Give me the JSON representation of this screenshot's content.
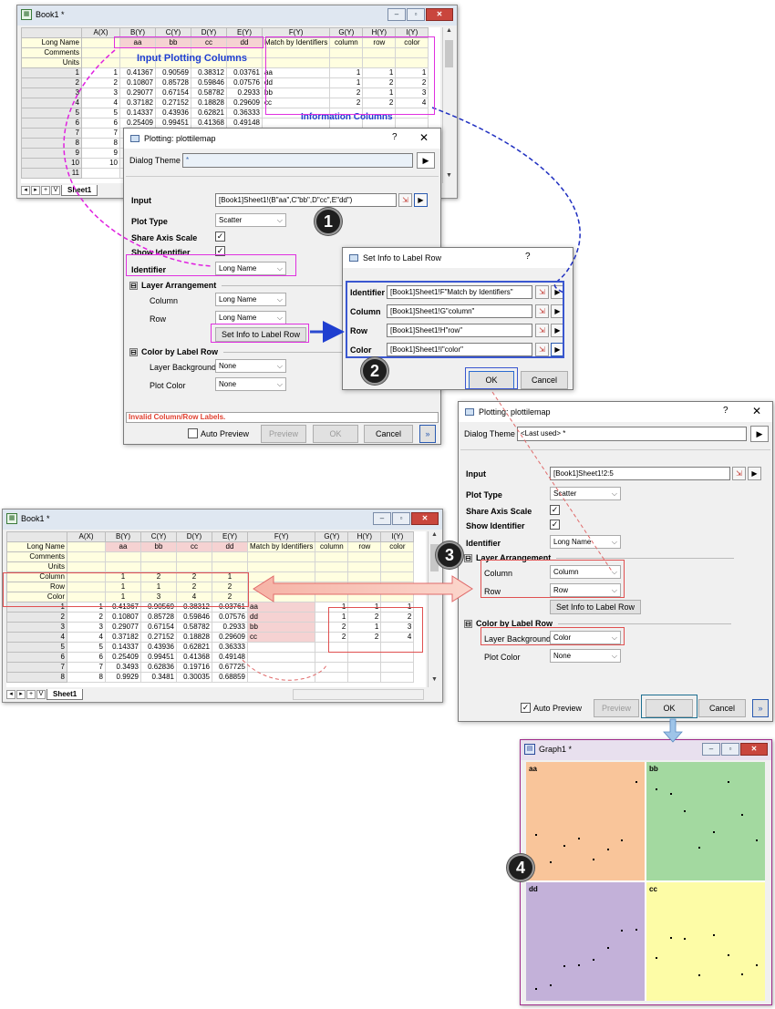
{
  "book_top": {
    "title": "Book1 *",
    "col_headers": [
      "A(X)",
      "B(Y)",
      "C(Y)",
      "D(Y)",
      "E(Y)",
      "F(Y)",
      "G(Y)",
      "H(Y)",
      "I(Y)"
    ],
    "row_labels": [
      "Long Name",
      "Comments",
      "Units"
    ],
    "long_names": [
      "",
      "aa",
      "bb",
      "cc",
      "dd",
      "Match by Identifiers",
      "column",
      "row",
      "color"
    ],
    "rows": [
      [
        "1",
        "1",
        "0.41367",
        "0.90569",
        "0.38312",
        "0.03761",
        "aa",
        "1",
        "1",
        "1"
      ],
      [
        "2",
        "2",
        "0.10807",
        "0.85728",
        "0.59846",
        "0.07576",
        "dd",
        "1",
        "2",
        "2"
      ],
      [
        "3",
        "3",
        "0.29077",
        "0.67154",
        "0.58782",
        "0.2933",
        "bb",
        "2",
        "1",
        "3"
      ],
      [
        "4",
        "4",
        "0.37182",
        "0.27152",
        "0.18828",
        "0.29609",
        "cc",
        "2",
        "2",
        "4"
      ],
      [
        "5",
        "5",
        "0.14337",
        "0.43936",
        "0.62821",
        "0.36333",
        "",
        "",
        "",
        ""
      ],
      [
        "6",
        "6",
        "0.25409",
        "0.99451",
        "0.41368",
        "0.49148",
        "",
        "",
        "",
        ""
      ],
      [
        "7",
        "7",
        "",
        "",
        "",
        "",
        "",
        "",
        "",
        ""
      ],
      [
        "8",
        "8",
        "",
        "",
        "",
        "",
        "",
        "",
        "",
        ""
      ],
      [
        "9",
        "9",
        "0.",
        "",
        "",
        "",
        "",
        "",
        "",
        ""
      ],
      [
        "10",
        "10",
        "0.",
        "",
        "",
        "",
        "",
        "",
        "",
        ""
      ],
      [
        "11",
        "",
        "",
        "",
        "",
        "",
        "",
        "",
        "",
        ""
      ]
    ],
    "sheet_tab": "Sheet1",
    "nav_buttons": [
      "◂",
      "▸",
      "+",
      "V"
    ]
  },
  "annotations": {
    "input_cols": "Input Plotting Columns",
    "info_cols": "Information Columns"
  },
  "dialog1": {
    "title": "Plotting: plottilemap",
    "help": "?",
    "close": "✕",
    "theme_label": "Dialog Theme",
    "theme_value": "*",
    "input_label": "Input",
    "input_value": "[Book1]Sheet1!(B\"aa\",C\"bb\",D\"cc\",E\"dd\")",
    "plot_type_label": "Plot Type",
    "plot_type_value": "Scatter",
    "share_axis_label": "Share Axis Scale",
    "show_identifier_label": "Show Identifier",
    "identifier_label": "Identifier",
    "identifier_value": "Long Name",
    "layer_arr_label": "Layer Arrangement",
    "column_label": "Column",
    "column_value": "Long Name",
    "row_label": "Row",
    "row_value": "Long Name",
    "set_info_btn": "Set Info to Label Row",
    "color_by_label": "Color by Label Row",
    "layer_bg_label": "Layer Background",
    "layer_bg_value": "None",
    "plot_color_label": "Plot Color",
    "plot_color_value": "None",
    "status": "Invalid Column/Row Labels.",
    "auto_preview": "Auto Preview",
    "preview_btn": "Preview",
    "ok_btn": "OK",
    "cancel_btn": "Cancel",
    "more_btn": "»",
    "expand": "⊟"
  },
  "setinfo": {
    "title": "Set Info to Label Row",
    "help": "?",
    "identifier_label": "Identifier",
    "identifier_value": "[Book1]Sheet1!F\"Match by Identifiers\"",
    "column_label": "Column",
    "column_value": "[Book1]Sheet1!G\"column\"",
    "row_label": "Row",
    "row_value": "[Book1]Sheet1!H\"row\"",
    "color_label": "Color",
    "color_value": "[Book1]Sheet1!I\"color\"",
    "ok_btn": "OK",
    "cancel_btn": "Cancel"
  },
  "dialog2": {
    "title": "Plotting: plottilemap",
    "help": "?",
    "close": "✕",
    "theme_label": "Dialog Theme",
    "theme_value": "<Last used> *",
    "input_label": "Input",
    "input_value": "[Book1]Sheet1!2:5",
    "plot_type_label": "Plot Type",
    "plot_type_value": "Scatter",
    "share_axis_label": "Share Axis Scale",
    "show_identifier_label": "Show Identifier",
    "identifier_label": "Identifier",
    "identifier_value": "Long Name",
    "layer_arr_label": "Layer Arrangement",
    "column_label": "Column",
    "column_value": "Column",
    "row_label": "Row",
    "row_value": "Row",
    "set_info_btn": "Set Info to Label Row",
    "color_by_label": "Color by Label Row",
    "layer_bg_label": "Layer Background",
    "layer_bg_value": "Color",
    "plot_color_label": "Plot Color",
    "plot_color_value": "None",
    "auto_preview": "Auto Preview",
    "preview_btn": "Preview",
    "ok_btn": "OK",
    "cancel_btn": "Cancel",
    "more_btn": "»"
  },
  "book_bottom": {
    "title": "Book1 *",
    "col_headers": [
      "A(X)",
      "B(Y)",
      "C(Y)",
      "D(Y)",
      "E(Y)",
      "F(Y)",
      "G(Y)",
      "H(Y)",
      "I(Y)"
    ],
    "long_names": [
      "",
      "aa",
      "bb",
      "cc",
      "dd",
      "Match by Identifiers",
      "column",
      "row",
      "color"
    ],
    "label_rows": [
      {
        "name": "Long Name",
        "vals": [
          "",
          "aa",
          "bb",
          "cc",
          "dd",
          "Match by Identifiers",
          "column",
          "row",
          "color"
        ]
      },
      {
        "name": "Comments",
        "vals": [
          "",
          "",
          "",
          "",
          "",
          "",
          "",
          "",
          ""
        ]
      },
      {
        "name": "Units",
        "vals": [
          "",
          "",
          "",
          "",
          "",
          "",
          "",
          "",
          ""
        ]
      },
      {
        "name": "Column",
        "vals": [
          "",
          "1",
          "2",
          "2",
          "1",
          "",
          "",
          "",
          ""
        ]
      },
      {
        "name": "Row",
        "vals": [
          "",
          "1",
          "1",
          "2",
          "2",
          "",
          "",
          "",
          ""
        ]
      },
      {
        "name": "Color",
        "vals": [
          "",
          "1",
          "3",
          "4",
          "2",
          "",
          "",
          "",
          ""
        ]
      }
    ],
    "rows": [
      [
        "1",
        "1",
        "0.41367",
        "0.90569",
        "0.38312",
        "0.03761",
        "aa",
        "1",
        "1",
        "1"
      ],
      [
        "2",
        "2",
        "0.10807",
        "0.85728",
        "0.59846",
        "0.07576",
        "dd",
        "1",
        "2",
        "2"
      ],
      [
        "3",
        "3",
        "0.29077",
        "0.67154",
        "0.58782",
        "0.2933",
        "bb",
        "2",
        "1",
        "3"
      ],
      [
        "4",
        "4",
        "0.37182",
        "0.27152",
        "0.18828",
        "0.29609",
        "cc",
        "2",
        "2",
        "4"
      ],
      [
        "5",
        "5",
        "0.14337",
        "0.43936",
        "0.62821",
        "0.36333",
        "",
        "",
        "",
        ""
      ],
      [
        "6",
        "6",
        "0.25409",
        "0.99451",
        "0.41368",
        "0.49148",
        "",
        "",
        "",
        ""
      ],
      [
        "7",
        "7",
        "0.3493",
        "0.62836",
        "0.19716",
        "0.67725",
        "",
        "",
        "",
        ""
      ],
      [
        "8",
        "8",
        "0.9929",
        "0.3481",
        "0.30035",
        "0.68859",
        "",
        "",
        "",
        ""
      ]
    ],
    "sheet_tab": "Sheet1",
    "nav_buttons": [
      "◂",
      "▸",
      "+",
      "V"
    ]
  },
  "graph": {
    "title": "Graph1 *",
    "panels": [
      {
        "label": "aa",
        "color": "#f9c59a"
      },
      {
        "label": "bb",
        "color": "#a3d9a0"
      },
      {
        "label": "dd",
        "color": "#c3b1d9"
      },
      {
        "label": "cc",
        "color": "#fdfca6"
      }
    ]
  },
  "badges": [
    "1",
    "2",
    "3",
    "4"
  ]
}
